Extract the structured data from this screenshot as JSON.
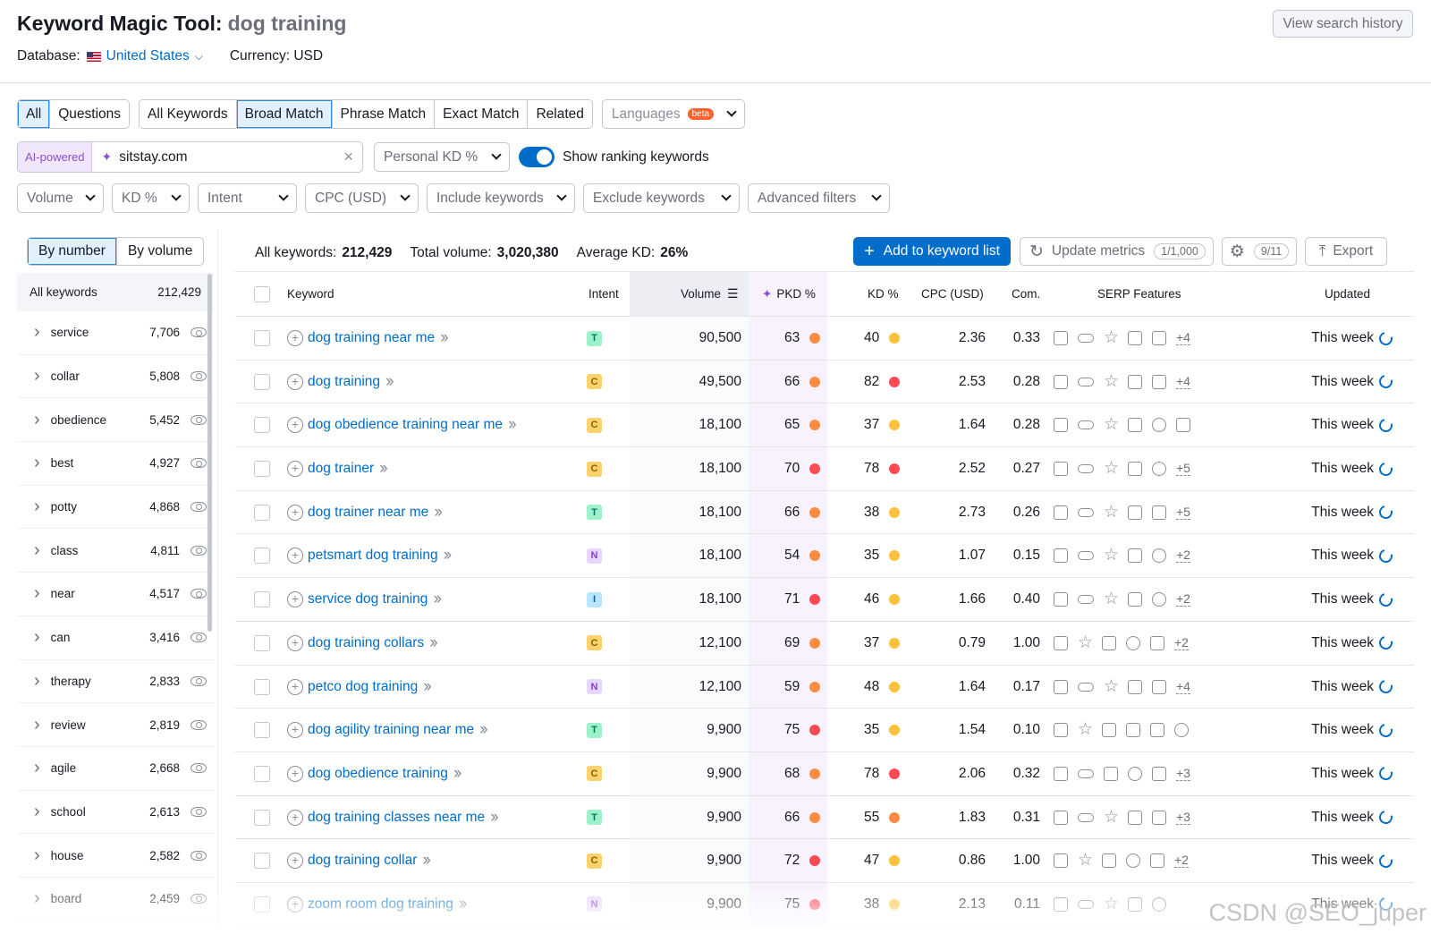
{
  "header": {
    "title": "Keyword Magic Tool:",
    "query": "dog training",
    "view_history": "View search history",
    "database_label": "Database:",
    "country": "United States",
    "currency": "Currency: USD"
  },
  "tabs": {
    "type": [
      "All",
      "Questions"
    ],
    "match": [
      "All Keywords",
      "Broad Match",
      "Phrase Match",
      "Exact Match",
      "Related"
    ],
    "languages": "Languages",
    "beta": "beta"
  },
  "ai": {
    "label": "AI-powered",
    "domain": "sitstay.com",
    "personal_kd": "Personal KD %",
    "show_ranking": "Show ranking keywords"
  },
  "filters": [
    "Volume",
    "KD %",
    "Intent",
    "CPC (USD)",
    "Include keywords",
    "Exclude keywords",
    "Advanced filters"
  ],
  "sidebar": {
    "by_number": "By number",
    "by_volume": "By volume",
    "all_label": "All keywords",
    "all_count": "212,429",
    "groups": [
      {
        "name": "service",
        "count": "7,706"
      },
      {
        "name": "collar",
        "count": "5,808"
      },
      {
        "name": "obedience",
        "count": "5,452"
      },
      {
        "name": "best",
        "count": "4,927"
      },
      {
        "name": "potty",
        "count": "4,868"
      },
      {
        "name": "class",
        "count": "4,811"
      },
      {
        "name": "near",
        "count": "4,517"
      },
      {
        "name": "can",
        "count": "3,416"
      },
      {
        "name": "therapy",
        "count": "2,833"
      },
      {
        "name": "review",
        "count": "2,819"
      },
      {
        "name": "agile",
        "count": "2,668"
      },
      {
        "name": "school",
        "count": "2,613"
      },
      {
        "name": "house",
        "count": "2,582"
      },
      {
        "name": "board",
        "count": "2,459"
      }
    ]
  },
  "summary": {
    "all_label": "All keywords:",
    "all_value": "212,429",
    "vol_label": "Total volume:",
    "vol_value": "3,020,380",
    "kd_label": "Average KD:",
    "kd_value": "26%"
  },
  "toolbar": {
    "add": "Add to keyword list",
    "update": "Update metrics",
    "update_count": "1/1,000",
    "settings_count": "9/11",
    "export": "Export"
  },
  "columns": {
    "keyword": "Keyword",
    "intent": "Intent",
    "volume": "Volume",
    "pkd": "PKD %",
    "kd": "KD %",
    "cpc": "CPC (USD)",
    "com": "Com.",
    "serp": "SERP Features",
    "updated": "Updated"
  },
  "intent_colors": {
    "T": {
      "bg": "#9ef2c9",
      "fg": "#007c65"
    },
    "C": {
      "bg": "#fcd26c",
      "fg": "#8d5f00"
    },
    "N": {
      "bg": "#e7d6ff",
      "fg": "#8442c4"
    },
    "I": {
      "bg": "#b9e6ff",
      "fg": "#005eae"
    }
  },
  "dot_colors": {
    "orange": "#ff8c43",
    "red": "#ff4953",
    "yellow": "#fdc23c"
  },
  "rows": [
    {
      "keyword": "dog training near me",
      "intent": "T",
      "volume": "90,500",
      "pkd": "63",
      "pkd_c": "orange",
      "kd": "40",
      "kd_c": "yellow",
      "cpc": "2.36",
      "com": "0.33",
      "serp": [
        "snippet",
        "link",
        "star",
        "image",
        "video"
      ],
      "more": "+4",
      "updated": "This week"
    },
    {
      "keyword": "dog training",
      "intent": "C",
      "volume": "49,500",
      "pkd": "66",
      "pkd_c": "orange",
      "kd": "82",
      "kd_c": "red",
      "cpc": "2.53",
      "com": "0.28",
      "serp": [
        "snippet",
        "link",
        "star",
        "image",
        "imgplus"
      ],
      "more": "+4",
      "updated": "This week"
    },
    {
      "keyword": "dog obedience training near me",
      "intent": "C",
      "volume": "18,100",
      "pkd": "65",
      "pkd_c": "orange",
      "kd": "37",
      "kd_c": "yellow",
      "cpc": "1.64",
      "com": "0.28",
      "serp": [
        "snippet",
        "link",
        "star",
        "review",
        "pin",
        "list"
      ],
      "more": "",
      "updated": "This week"
    },
    {
      "keyword": "dog trainer",
      "intent": "C",
      "volume": "18,100",
      "pkd": "70",
      "pkd_c": "red",
      "kd": "78",
      "kd_c": "red",
      "cpc": "2.52",
      "com": "0.27",
      "serp": [
        "snippet",
        "link",
        "star",
        "image",
        "play"
      ],
      "more": "+5",
      "updated": "This week"
    },
    {
      "keyword": "dog trainer near me",
      "intent": "T",
      "volume": "18,100",
      "pkd": "66",
      "pkd_c": "orange",
      "kd": "38",
      "kd_c": "yellow",
      "cpc": "2.73",
      "com": "0.26",
      "serp": [
        "snippet",
        "link",
        "star",
        "image",
        "imgplus"
      ],
      "more": "+5",
      "updated": "This week"
    },
    {
      "keyword": "petsmart dog training",
      "intent": "N",
      "volume": "18,100",
      "pkd": "54",
      "pkd_c": "orange",
      "kd": "35",
      "kd_c": "yellow",
      "cpc": "1.07",
      "com": "0.15",
      "serp": [
        "snippet",
        "link",
        "star",
        "imgplus",
        "play"
      ],
      "more": "+2",
      "updated": "This week"
    },
    {
      "keyword": "service dog training",
      "intent": "I",
      "volume": "18,100",
      "pkd": "71",
      "pkd_c": "red",
      "kd": "46",
      "kd_c": "yellow",
      "cpc": "1.66",
      "com": "0.40",
      "serp": [
        "snippet",
        "link",
        "star",
        "imgplus",
        "play"
      ],
      "more": "+2",
      "updated": "This week"
    },
    {
      "keyword": "dog training collars",
      "intent": "C",
      "volume": "12,100",
      "pkd": "69",
      "pkd_c": "orange",
      "kd": "37",
      "kd_c": "yellow",
      "cpc": "0.79",
      "com": "1.00",
      "serp": [
        "snippet",
        "star",
        "image",
        "play",
        "review"
      ],
      "more": "+2",
      "updated": "This week"
    },
    {
      "keyword": "petco dog training",
      "intent": "N",
      "volume": "12,100",
      "pkd": "59",
      "pkd_c": "orange",
      "kd": "48",
      "kd_c": "yellow",
      "cpc": "1.64",
      "com": "0.17",
      "serp": [
        "snippet",
        "link",
        "star",
        "image",
        "imgplus"
      ],
      "more": "+4",
      "updated": "This week"
    },
    {
      "keyword": "dog agility training near me",
      "intent": "T",
      "volume": "9,900",
      "pkd": "75",
      "pkd_c": "red",
      "kd": "35",
      "kd_c": "yellow",
      "cpc": "1.54",
      "com": "0.10",
      "serp": [
        "snippet",
        "star",
        "imgplus",
        "video",
        "review",
        "pin"
      ],
      "more": "",
      "updated": "This week"
    },
    {
      "keyword": "dog obedience training",
      "intent": "C",
      "volume": "9,900",
      "pkd": "68",
      "pkd_c": "orange",
      "kd": "78",
      "kd_c": "red",
      "cpc": "2.06",
      "com": "0.32",
      "serp": [
        "snippet",
        "link",
        "imgplus",
        "play",
        "review"
      ],
      "more": "+3",
      "updated": "This week"
    },
    {
      "keyword": "dog training classes near me",
      "intent": "T",
      "volume": "9,900",
      "pkd": "66",
      "pkd_c": "orange",
      "kd": "55",
      "kd_c": "orange",
      "cpc": "1.83",
      "com": "0.31",
      "serp": [
        "snippet",
        "link",
        "star",
        "imgplus",
        "review"
      ],
      "more": "+3",
      "updated": "This week"
    },
    {
      "keyword": "dog training collar",
      "intent": "C",
      "volume": "9,900",
      "pkd": "72",
      "pkd_c": "red",
      "kd": "47",
      "kd_c": "yellow",
      "cpc": "0.86",
      "com": "1.00",
      "serp": [
        "snippet",
        "star",
        "image",
        "play",
        "review"
      ],
      "more": "+2",
      "updated": "This week"
    },
    {
      "keyword": "zoom room dog training",
      "intent": "N",
      "volume": "9,900",
      "pkd": "75",
      "pkd_c": "red",
      "kd": "38",
      "kd_c": "yellow",
      "cpc": "2.13",
      "com": "0.11",
      "serp": [
        "snippet",
        "link",
        "star",
        "image",
        "play"
      ],
      "more": "",
      "updated": "This week"
    }
  ],
  "watermark": "CSDN @SEO_juper"
}
